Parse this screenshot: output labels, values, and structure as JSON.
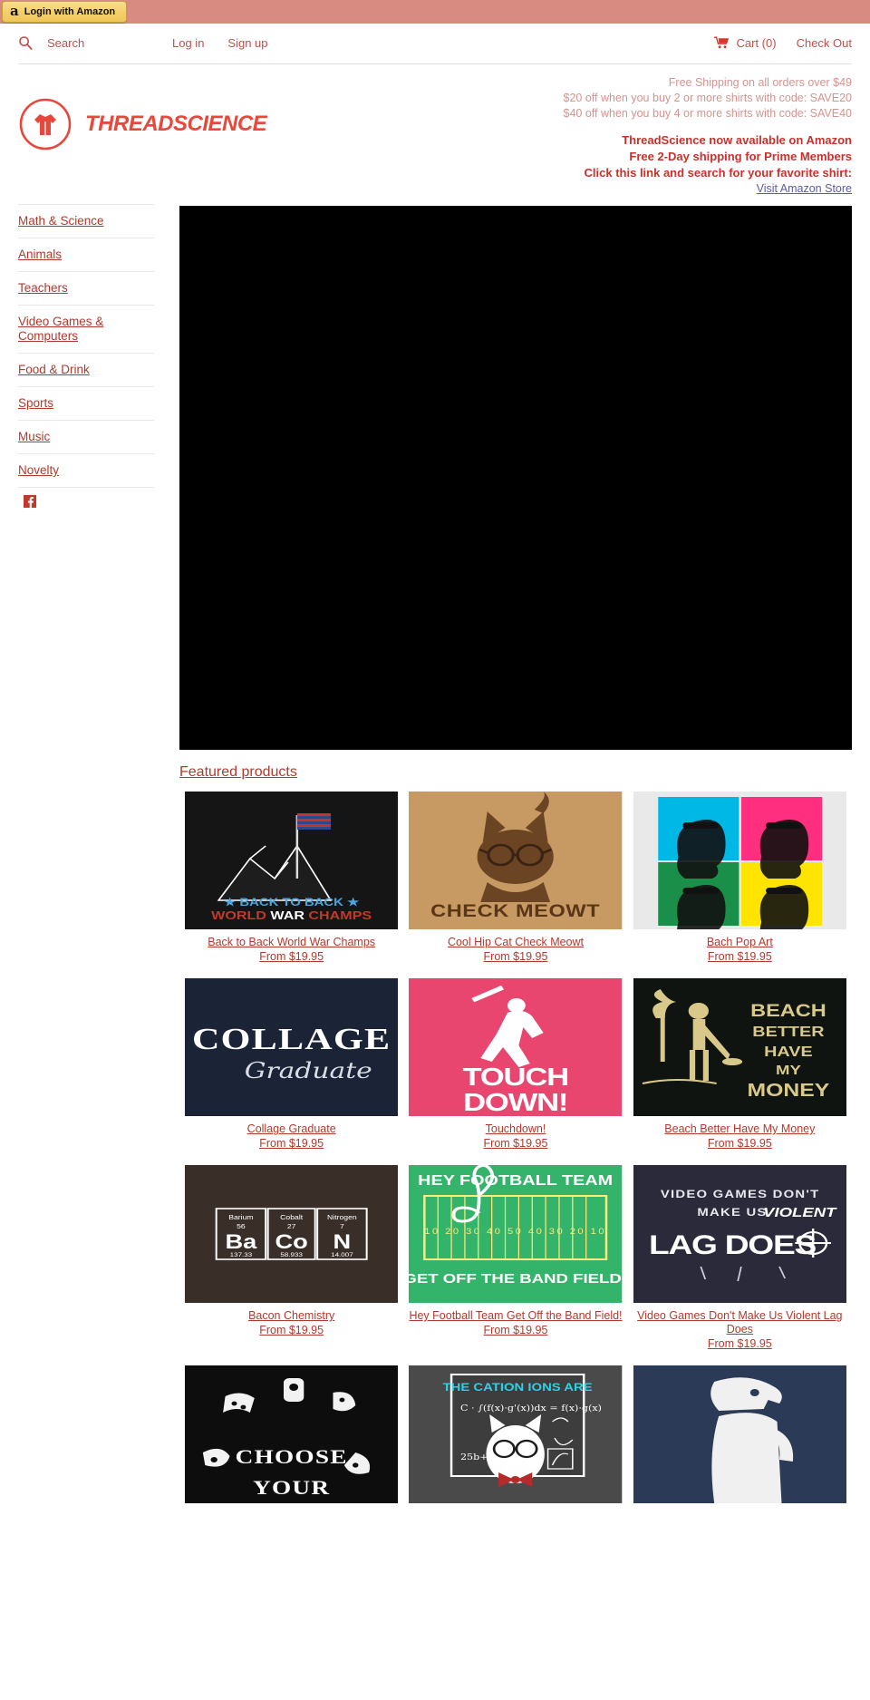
{
  "amazon_strip": {
    "login_label": "Login with Amazon",
    "logo_glyph": "a"
  },
  "utility": {
    "search_placeholder": "Search",
    "search_value": "",
    "search_icon": "search-icon",
    "login_label": "Log in",
    "signup_label": "Sign up",
    "cart_label": "Cart (0)",
    "cart_icon": "shopping-cart-icon",
    "checkout_label": "Check Out"
  },
  "brand": {
    "name": "THREADSCIENCE",
    "logo_icon": "tshirt-in-circle-logo",
    "color": "#e8483c"
  },
  "promo": {
    "lines": [
      "Free Shipping on all orders over $49",
      "$20 off when you buy 2 or more shirts with code: SAVE20",
      "$40 off when you buy 4 or more shirts with code: SAVE40"
    ],
    "strong_lines": [
      "ThreadScience now available on Amazon",
      "Free 2-Day shipping for Prime Members",
      "Click this link and search for your favorite shirt:"
    ],
    "amazon_link_label": "Visit Amazon Store",
    "muted_color": "#d39490",
    "strong_color": "#c9302c",
    "link_color": "#5b5ba8"
  },
  "sidebar": {
    "items": [
      {
        "label": "Math & Science"
      },
      {
        "label": "Animals"
      },
      {
        "label": "Teachers"
      },
      {
        "label": "Video Games & Computers"
      },
      {
        "label": "Food & Drink"
      },
      {
        "label": "Sports"
      },
      {
        "label": "Music"
      },
      {
        "label": "Novelty"
      }
    ],
    "social": [
      {
        "name": "facebook-icon",
        "label": "Facebook"
      }
    ]
  },
  "hero": {
    "background_color": "#000000",
    "alt": "hero-banner"
  },
  "featured": {
    "heading": "Featured products"
  },
  "products": [
    {
      "title": "Back to Back World War Champs",
      "price": "From $19.95",
      "art": "champs"
    },
    {
      "title": "Cool Hip Cat Check Meowt",
      "price": "From $19.95",
      "art": "meowt"
    },
    {
      "title": "Bach Pop Art",
      "price": "From $19.95",
      "art": "bach"
    },
    {
      "title": "Collage Graduate",
      "price": "From $19.95",
      "art": "collage"
    },
    {
      "title": "Touchdown!",
      "price": "From $19.95",
      "art": "touchdown"
    },
    {
      "title": "Beach Better Have My Money",
      "price": "From $19.95",
      "art": "beach"
    },
    {
      "title": "Bacon Chemistry",
      "price": "From $19.95",
      "art": "bacon"
    },
    {
      "title": "Hey Football Team Get Off the Band Field!",
      "price": "From $19.95",
      "art": "bandfield"
    },
    {
      "title": "Video Games Don't Make Us Violent Lag Does",
      "price": "From $19.95",
      "art": "lagdoes"
    },
    {
      "title": "",
      "price": "",
      "art": "choose"
    },
    {
      "title": "",
      "price": "",
      "art": "cation"
    },
    {
      "title": "",
      "price": "",
      "art": "dog"
    }
  ],
  "product_art_text": {
    "champs": {
      "l1": "★ BACK TO BACK ★",
      "l2a": "WORLD ",
      "l2b": "WAR ",
      "l2c": "CHAMPS"
    },
    "meowt": {
      "l1": "CHECK MEOWT"
    },
    "collage": {
      "l1": "COLLAGE",
      "l2": "Graduate"
    },
    "touchdown": {
      "l1": "TOUCH",
      "l2": "DOWN!"
    },
    "beach": {
      "l1": "BEACH",
      "l2": "BETTER",
      "l3": "HAVE",
      "l4": "MY",
      "l5": "MONEY"
    },
    "bacon": {
      "e1_name": "Barium",
      "e1_num": "56",
      "e1_sym": "Ba",
      "e1_mass": "137.33",
      "e2_name": "Cobalt",
      "e2_num": "27",
      "e2_sym": "Co",
      "e2_mass": "58.933",
      "e3_name": "Nitrogen",
      "e3_num": "7",
      "e3_sym": "N",
      "e3_mass": "14.007"
    },
    "bandfield": {
      "l1": "HEY FOOTBALL TEAM",
      "l2": "GET OFF THE BAND FIELD!"
    },
    "lagdoes": {
      "l1": "VIDEO GAMES DON'T",
      "l2a": "MAKE US ",
      "l2b": "VIOLENT",
      "l3": "LAG DOES"
    },
    "choose": {
      "l1": "CHOOSE",
      "l2": "YOUR"
    },
    "cation": {
      "l1": "THE CATION IONS ARE"
    }
  }
}
